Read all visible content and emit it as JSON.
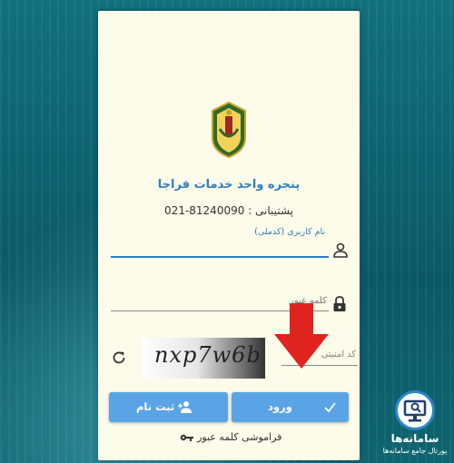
{
  "page": {
    "title": "پنجره واحد خدمات فراجا",
    "support_label": "پشتیبانی :",
    "support_number": "021-81240090"
  },
  "form": {
    "username_label": "نام کاربری (کدملی)",
    "username_value": "",
    "password_placeholder": "کلمه عبور",
    "captcha_placeholder": "کد امنیتی",
    "captcha_text": "nxp7w6b",
    "login_button": "ورود",
    "register_button": "ثبت نام",
    "forgot_password": "فراموشی کلمه عبور"
  },
  "watermark": {
    "title": "سامانه‌ها",
    "subtitle": "پورتال جامع سامانه‌ها"
  },
  "colors": {
    "accent": "#2f7fc1",
    "button": "#5aa4e6",
    "arrow": "#e0231e",
    "card": "#fdfbe9"
  },
  "icons": [
    "police-emblem-icon",
    "user-icon",
    "lock-icon",
    "refresh-icon",
    "check-icon",
    "add-user-icon",
    "key-icon",
    "red-arrow-icon"
  ]
}
